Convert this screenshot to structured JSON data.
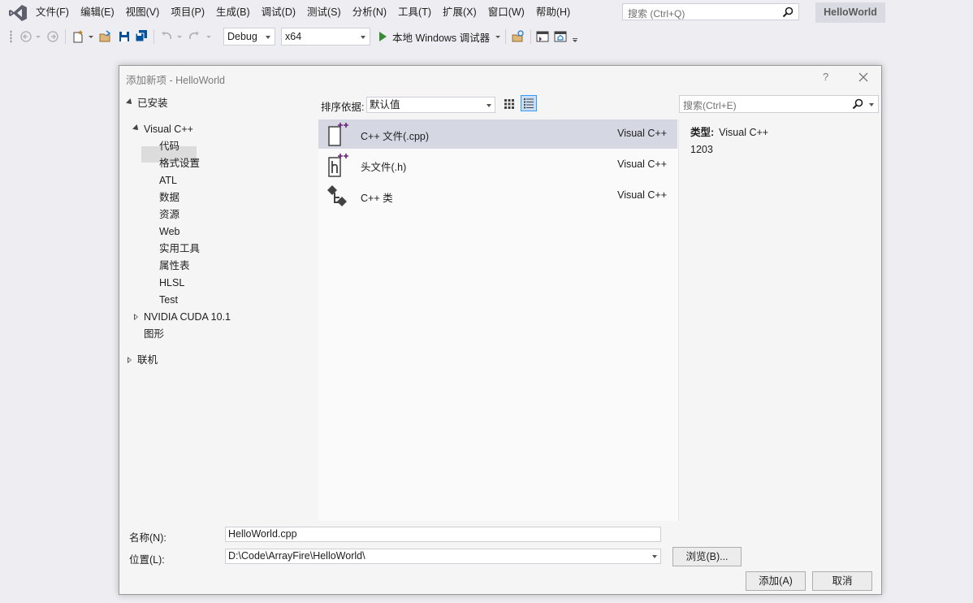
{
  "menu": {
    "items": [
      "文件(F)",
      "编辑(E)",
      "视图(V)",
      "项目(P)",
      "生成(B)",
      "调试(D)",
      "测试(S)",
      "分析(N)",
      "工具(T)",
      "扩展(X)",
      "窗口(W)",
      "帮助(H)"
    ],
    "search_placeholder": "搜索 (Ctrl+Q)",
    "solution_name": "HelloWorld"
  },
  "toolbar": {
    "config": "Debug",
    "platform": "x64",
    "run_label": "本地 Windows 调试器"
  },
  "dialog": {
    "title": "添加新项 - HelloWorld",
    "help": "?",
    "tree": {
      "installed": "已安装",
      "visual_cpp": "Visual C++",
      "children": [
        "代码",
        "格式设置",
        "ATL",
        "数据",
        "资源",
        "Web",
        "实用工具",
        "属性表",
        "HLSL",
        "Test"
      ],
      "cuda": "NVIDIA CUDA 10.1",
      "graphics": "图形",
      "online": "联机"
    },
    "sort_label": "排序依据:",
    "sort_value": "默认值",
    "templates": [
      {
        "name": "C++ 文件(.cpp)",
        "type": "Visual C++"
      },
      {
        "name": "头文件(.h)",
        "type": "Visual C++"
      },
      {
        "name": "C++ 类",
        "type": "Visual C++"
      }
    ],
    "search_placeholder": "搜索(Ctrl+E)",
    "info": {
      "type_label": "类型:",
      "type_value": "Visual C++",
      "id": "1203"
    },
    "form": {
      "name_label": "名称(N):",
      "name_value": "HelloWorld.cpp",
      "location_label": "位置(L):",
      "location_value": "D:\\Code\\ArrayFire\\HelloWorld\\",
      "browse_label": "浏览(B)...",
      "add_label": "添加(A)",
      "cancel_label": "取消"
    }
  },
  "colors": {
    "accent": "#68217a",
    "selection": "#d5d8e3",
    "run": "#388a34"
  }
}
